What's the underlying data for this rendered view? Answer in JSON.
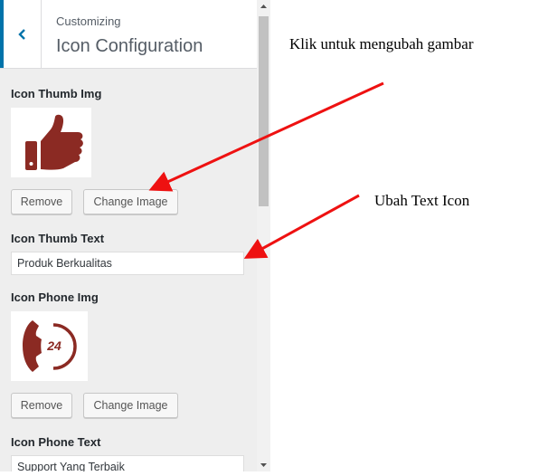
{
  "header": {
    "subtitle": "Customizing",
    "title": "Icon Configuration"
  },
  "sections": {
    "thumb_img_label": "Icon Thumb Img",
    "thumb_text_label": "Icon Thumb Text",
    "thumb_text_value": "Produk Berkualitas",
    "phone_img_label": "Icon Phone Img",
    "phone_text_label": "Icon Phone Text",
    "phone_text_value": "Support Yang Terbaik",
    "phone_icon_number": "24"
  },
  "buttons": {
    "remove": "Remove",
    "change_image": "Change Image"
  },
  "annotations": {
    "change_image_note": "Klik untuk mengubah gambar",
    "text_icon_note": "Ubah Text Icon"
  },
  "colors": {
    "icon": "#8b2a23",
    "arrow": "#ee1111",
    "accent": "#0073aa"
  },
  "icons": {
    "back": "chevron-left-icon",
    "thumb": "thumbs-up-icon",
    "phone": "phone-24-icon"
  }
}
